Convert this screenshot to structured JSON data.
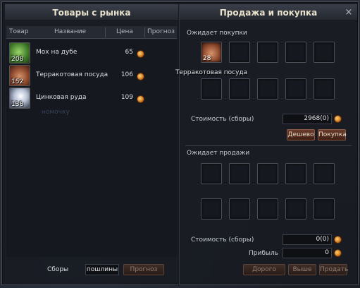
{
  "left_panel": {
    "title": "Товары с рынка",
    "columns": [
      "Товар",
      "Название",
      "Цена",
      "Прогноз"
    ],
    "items": [
      {
        "name": "Мох на дубе",
        "count": "208",
        "price": "65",
        "icon": "moss-icon"
      },
      {
        "name": "Терракотовая посуда",
        "count": "152",
        "price": "106",
        "icon": "pot-icon"
      },
      {
        "name": "Цинковая руда",
        "count": "138",
        "price": "109",
        "icon": "ore-icon"
      }
    ],
    "fees_label": "Сборы",
    "fees_value": "пошлины",
    "forecast_button": "Прогноз"
  },
  "right_panel": {
    "title": "Продажа и покупка",
    "close_icon": "×",
    "buy_section": {
      "label": "Ожидает покупки",
      "filled_slot_count": "28",
      "tooltip": "Терракотовая посуда",
      "cost_label": "Стоимость (сборы)",
      "cost_value": "2968(0)",
      "cheaper_button": "Дешево",
      "buy_button": "Покупка"
    },
    "sell_section": {
      "label": "Ожидает продажи",
      "cost_label": "Стоимость (сборы)",
      "cost_value": "0(0)",
      "profit_label": "Прибыль",
      "profit_value": "0",
      "expensive_button": "Дорого",
      "higher_button": "Выше",
      "sell_button": "Продать"
    }
  },
  "background_text": {
    "hint": "номочку"
  },
  "colors": {
    "accent_coin": "#d07a1e",
    "button": "#6a3a2a",
    "title_text": "#e8e2cc"
  }
}
